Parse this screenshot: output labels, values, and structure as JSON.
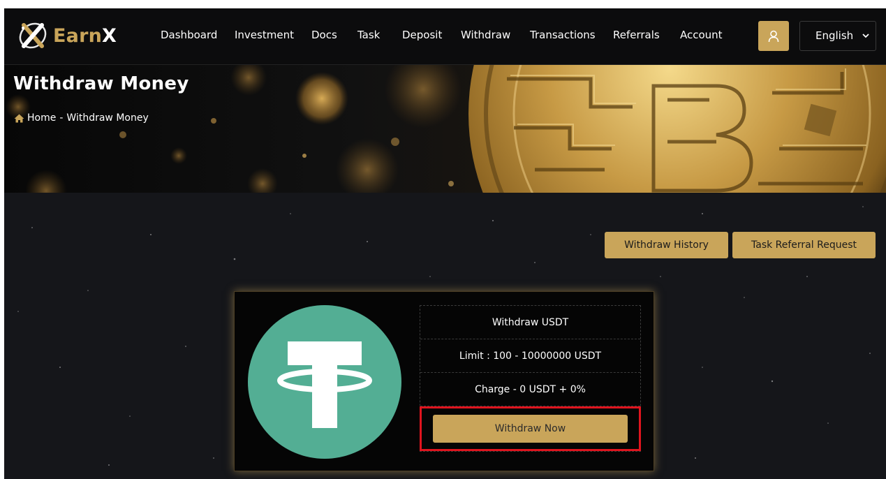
{
  "brand": {
    "name_part1": "Earn",
    "name_part2": "X",
    "logo_icon": "x-swirl-logo-icon",
    "accent_color": "#c9a55a"
  },
  "nav": {
    "items": [
      {
        "label": "Dashboard"
      },
      {
        "label": "Investment"
      },
      {
        "label": "Docs"
      },
      {
        "label": "Task"
      },
      {
        "label": "Deposit"
      },
      {
        "label": "Withdraw"
      },
      {
        "label": "Transactions"
      },
      {
        "label": "Referrals"
      },
      {
        "label": "Account"
      }
    ],
    "user_icon": "user-icon",
    "language": {
      "selected": "English"
    }
  },
  "banner": {
    "title": "Withdraw Money",
    "breadcrumb": {
      "home": "Home",
      "separator": "-",
      "current": "Withdraw Money"
    }
  },
  "actions": {
    "withdraw_history": "Withdraw History",
    "task_referral_request": "Task Referral Request"
  },
  "method": {
    "icon": "tether-usdt-icon",
    "icon_color": "#53ae94",
    "title": "Withdraw USDT",
    "limit": "Limit : 100 - 10000000 USDT",
    "charge": "Charge - 0 USDT + 0%",
    "button": "Withdraw Now",
    "highlight_color": "#e0141e"
  }
}
